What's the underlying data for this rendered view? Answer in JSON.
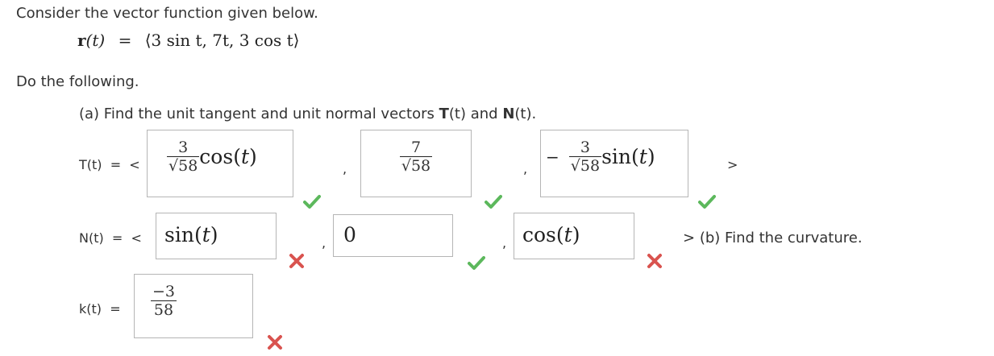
{
  "intro": "Consider the vector function given below.",
  "vector_function": {
    "lhs_bold": "r",
    "lhs_arg": "(t)",
    "equals": "=",
    "rhs": "⟨3 sin  t, 7t, 3 cos  t⟩"
  },
  "do_following": "Do the following.",
  "part_a": {
    "prefix": "(a) Find the unit tangent and unit normal vectors ",
    "T": "T",
    "mid": "(t) and ",
    "N": "N",
    "suffix": "(t)."
  },
  "T_row": {
    "label": "T(t)  =  <",
    "entry1": {
      "num": "3",
      "den": "58",
      "fn": "cos",
      "arg": "t"
    },
    "entry2": {
      "num": "7",
      "den": "58"
    },
    "entry3": {
      "sign": "−",
      "num": "3",
      "den": "58",
      "fn": "sin",
      "arg": "t"
    },
    "close": ">",
    "comma": ","
  },
  "N_row": {
    "label": "N(t)  =  <",
    "entry1": {
      "fn": "sin",
      "arg": "t"
    },
    "entry2": "0",
    "entry3": {
      "fn": "cos",
      "arg": "t"
    },
    "close": ">",
    "comma": ",",
    "part_b": "(b) Find the curvature."
  },
  "k_row": {
    "label": "k(t)  =",
    "num": "−3",
    "den": "58"
  },
  "colors": {
    "correct": "#5cb85c",
    "incorrect": "#d9534f",
    "box_border": "#b5b5b5"
  }
}
